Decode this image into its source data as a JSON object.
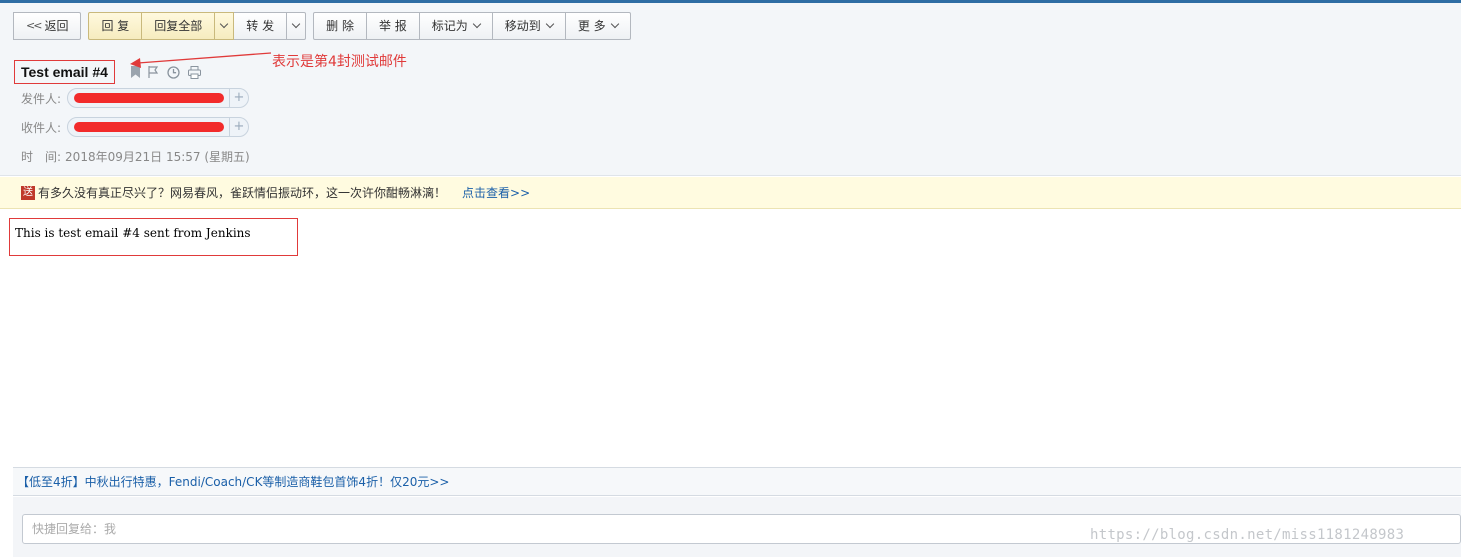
{
  "toolbar": {
    "back": "返回",
    "reply": "回 复",
    "reply_all": "回复全部",
    "forward": "转 发",
    "delete": "删 除",
    "report": "举 报",
    "mark_as": "标记为",
    "move_to": "移动到",
    "more": "更 多"
  },
  "email": {
    "subject": "Test email #4",
    "from_label": "发件人:",
    "to_label": "收件人:",
    "time_label": "时　间:",
    "time_value": "2018年09月21日 15:57 (星期五)",
    "body": "This is test email #4 sent from Jenkins"
  },
  "annotation": {
    "text": "表示是第4封测试邮件",
    "color": "#e03a3a"
  },
  "ad_bar": {
    "icon_text": "送",
    "text": "有多久没有真正尽兴了？网易春风，雀跃情侣振动环，这一次许你酣畅淋漓！",
    "link": "点击查看>>"
  },
  "promo": {
    "text": "【低至4折】中秋出行特惠，Fendi/Coach/CK等制造商鞋包首饰4折！仅20元>>"
  },
  "quick_reply": {
    "placeholder": "快捷回复给：我"
  },
  "watermark": "https://blog.csdn.net/miss1181248983",
  "icons": [
    "chevron-left-double-icon",
    "chevron-down-icon",
    "bookmark-icon",
    "flag-icon",
    "clock-icon",
    "print-icon",
    "plus-icon"
  ],
  "colors": {
    "accent": "#2e6da4",
    "link": "#1a5fa8",
    "highlight_border": "#e03a3a",
    "ad_background": "#fffbe0"
  }
}
